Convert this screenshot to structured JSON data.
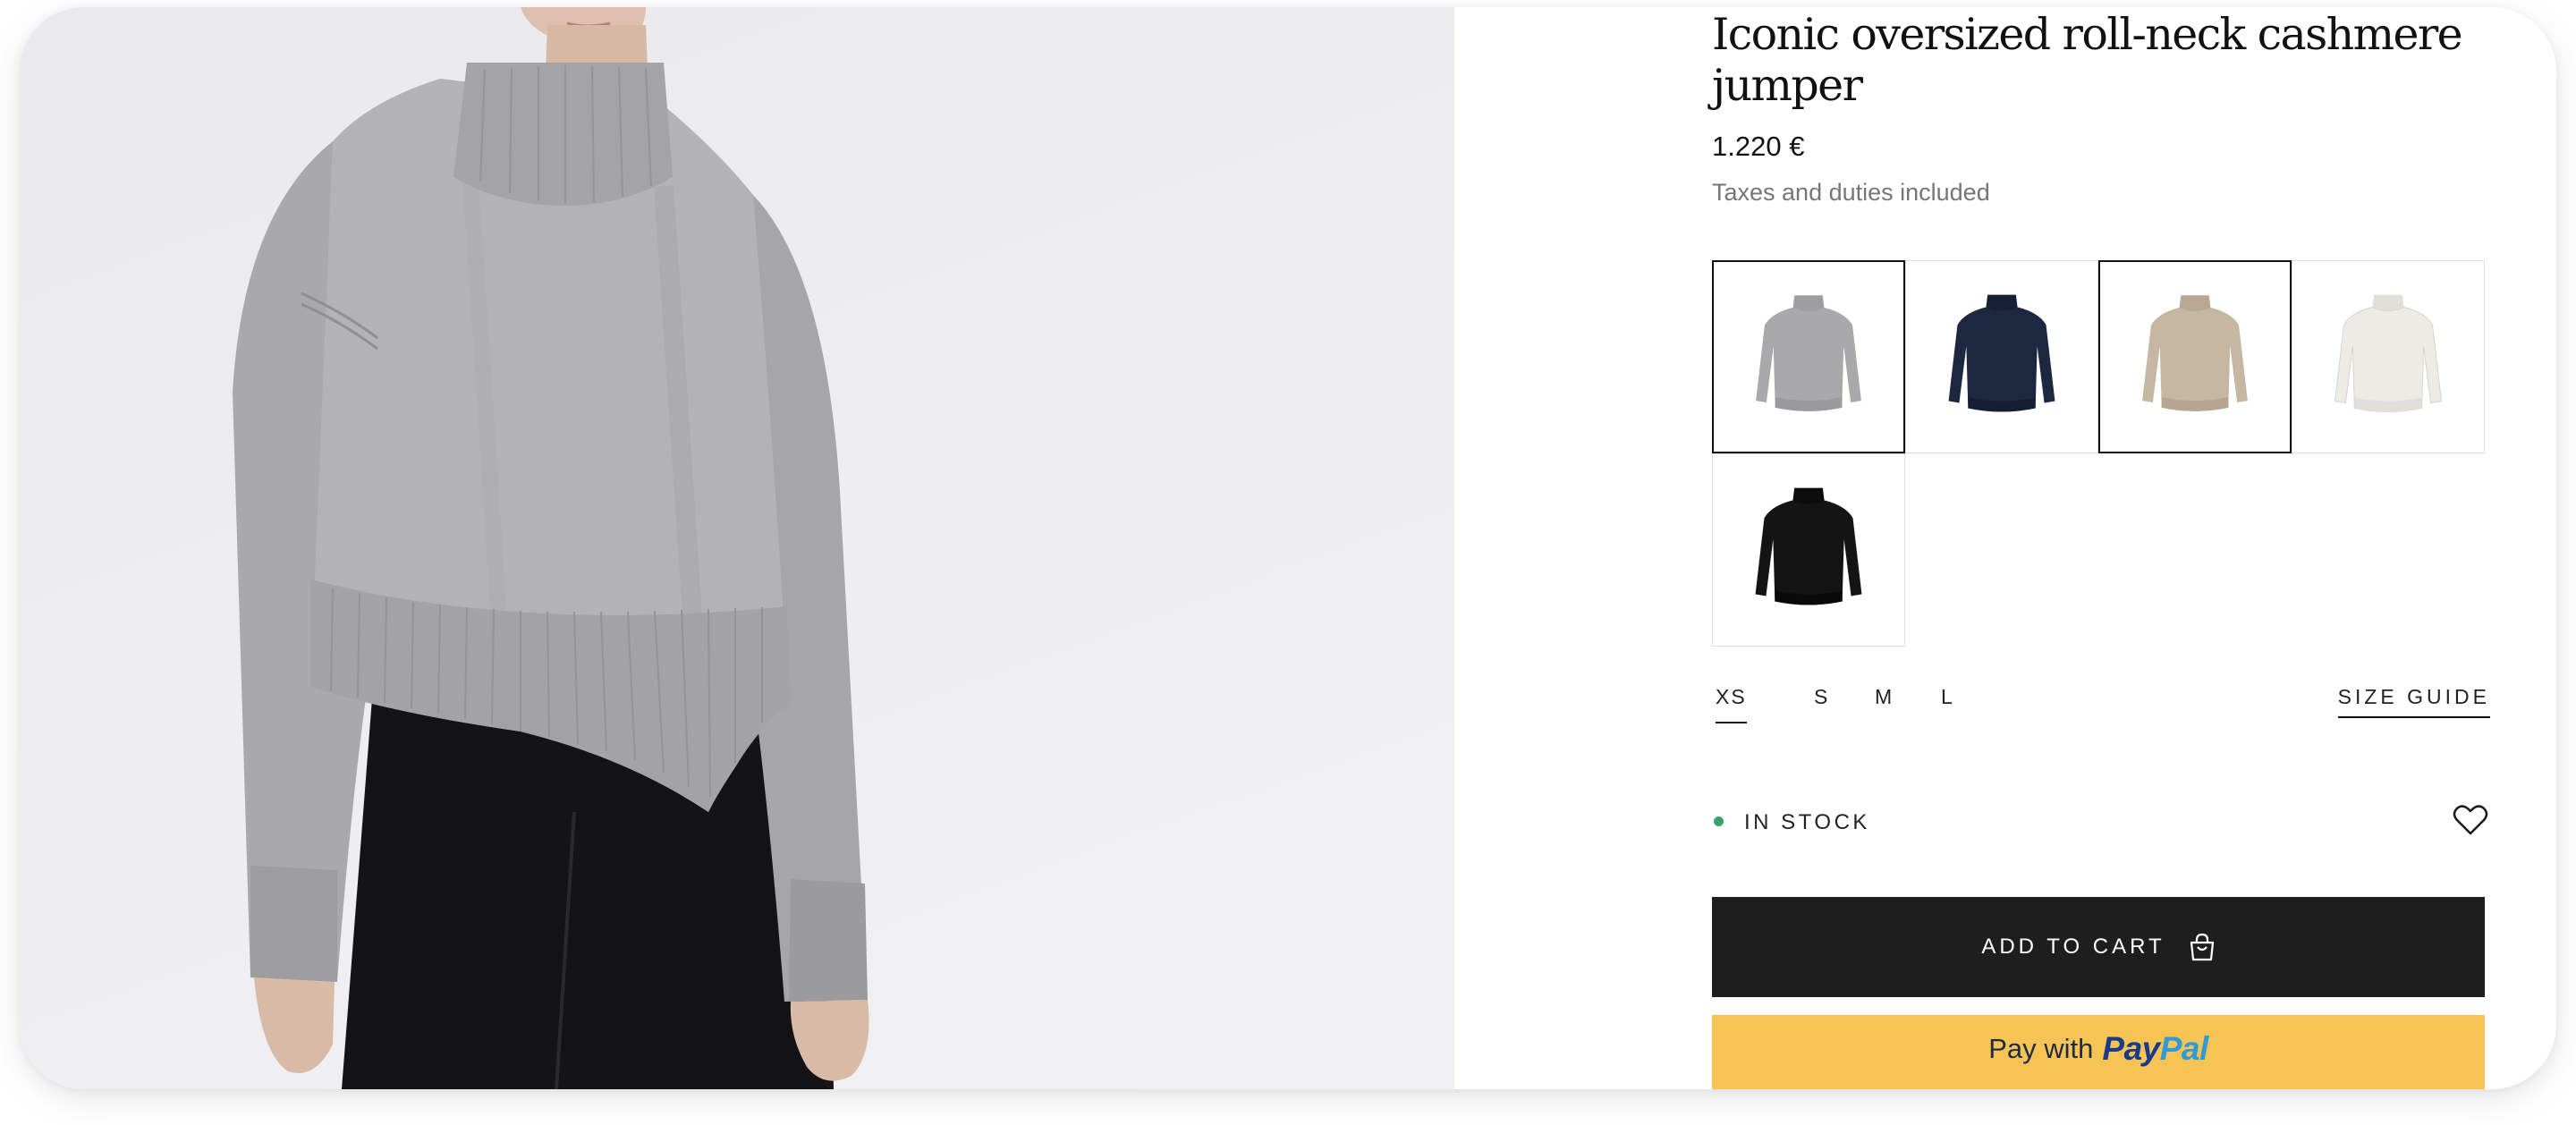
{
  "product": {
    "title": "Iconic oversized roll-neck cashmere jumper",
    "price": "1.220 €",
    "tax_note": "Taxes and duties included"
  },
  "colors": {
    "swatches": [
      {
        "name": "grey",
        "hex": "#a9a9ab",
        "selected": true
      },
      {
        "name": "navy",
        "hex": "#1d2740",
        "selected": false
      },
      {
        "name": "camel",
        "hex": "#c6b7a3",
        "selected": true
      },
      {
        "name": "ivory",
        "hex": "#ecebe6",
        "selected": false
      },
      {
        "name": "black",
        "hex": "#141414",
        "selected": false
      }
    ]
  },
  "sizes": {
    "options": [
      "XS",
      "S",
      "M",
      "L"
    ],
    "selected": "XS",
    "guide_label": "SIZE GUIDE"
  },
  "availability": {
    "label": "IN STOCK",
    "color": "#3aa36a"
  },
  "actions": {
    "add_to_cart": "ADD TO CART",
    "cart_icon": "shopping-bag-icon",
    "wishlist_icon": "heart-icon",
    "paypal_label": "Pay with",
    "paypal_brand_pay": "Pay",
    "paypal_brand_pal": "Pal"
  },
  "theme": {
    "button_dark": "#1e1e1e",
    "paypal_yellow": "#f6c454"
  }
}
